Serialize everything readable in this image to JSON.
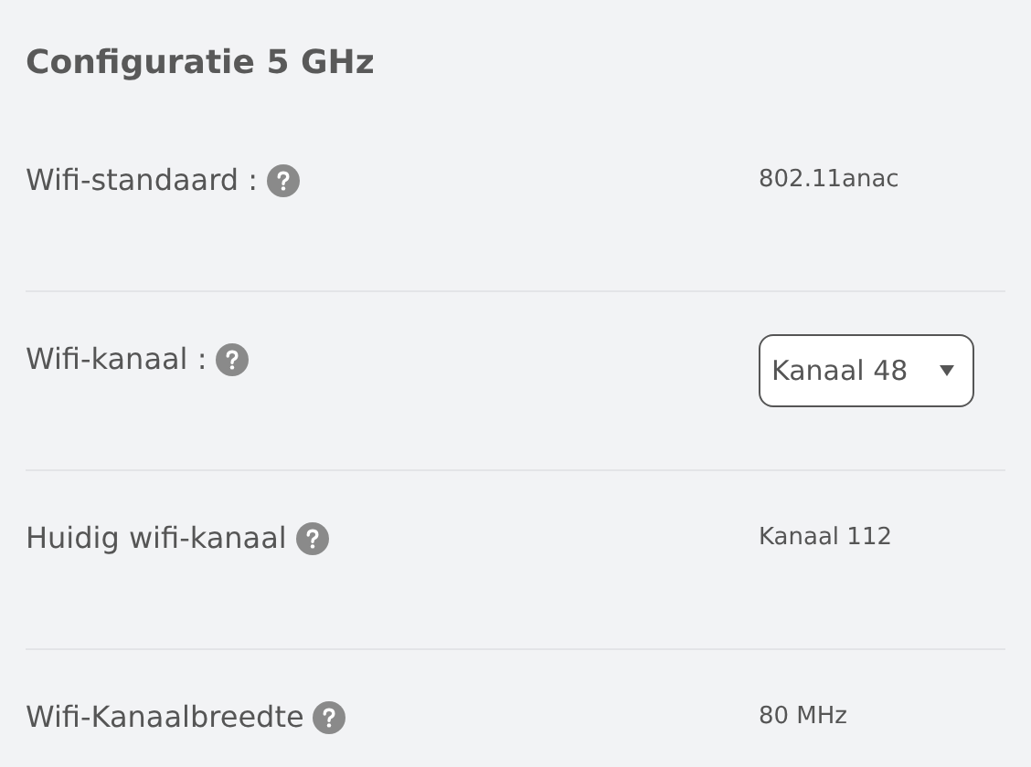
{
  "section": {
    "title": "Configuratie 5 GHz"
  },
  "rows": [
    {
      "kind": "text",
      "label": "Wifi-standaard :",
      "value": "802.11anac"
    },
    {
      "kind": "select",
      "label": "Wifi-kanaal :",
      "value": "Kanaal 48"
    },
    {
      "kind": "text",
      "label": "Huidig wifi-kanaal",
      "value": "Kanaal 112"
    },
    {
      "kind": "text",
      "label": "Wifi-Kanaalbreedte",
      "value": "80 MHz"
    }
  ]
}
